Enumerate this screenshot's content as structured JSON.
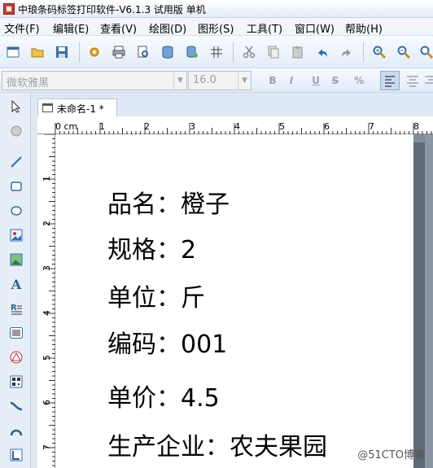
{
  "window": {
    "title": "中琅条码标签打印软件-V6.1.3 试用版 单机"
  },
  "menu": [
    "文件(F)",
    "编辑(E)",
    "查看(V)",
    "绘图(D)",
    "图形(S)",
    "工具(T)",
    "窗口(W)",
    "帮助(H)"
  ],
  "fontbar": {
    "font_name": "微软雅黑",
    "font_size": "16.0",
    "bold": "B",
    "italic": "I",
    "underline": "U",
    "strike": "S"
  },
  "document": {
    "tab_title": "未命名-1 *"
  },
  "ruler": {
    "unit_label": "0 cm",
    "h_ticks": [
      "1",
      "2",
      "3",
      "4",
      "5",
      "6",
      "7",
      "8"
    ],
    "v_ticks": [
      "1",
      "2",
      "3",
      "4",
      "5",
      "6",
      "7"
    ]
  },
  "label": {
    "lines": [
      "品名：橙子",
      "规格：2",
      "单位：斤",
      "编码：001",
      "单价：4.5",
      "生产企业：农夫果园"
    ]
  },
  "watermark": "@51CTO博客"
}
